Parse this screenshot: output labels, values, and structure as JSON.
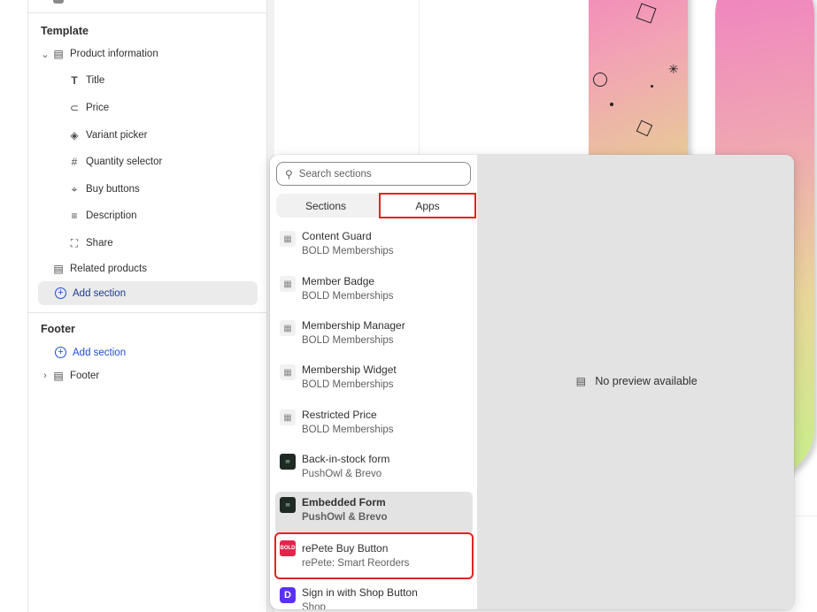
{
  "sidebar": {
    "template_title": "Template",
    "product_information": "Product information",
    "blocks": [
      {
        "label": "Title",
        "icon": "text-icon",
        "glyph": "T"
      },
      {
        "label": "Price",
        "icon": "price-tag-icon",
        "glyph": "⊂$"
      },
      {
        "label": "Variant picker",
        "icon": "variant-icon",
        "glyph": "◈"
      },
      {
        "label": "Quantity selector",
        "icon": "hash-icon",
        "glyph": "#"
      },
      {
        "label": "Buy buttons",
        "icon": "buy-button-icon",
        "glyph": "⌖"
      },
      {
        "label": "Description",
        "icon": "text-lines-icon",
        "glyph": "≡"
      },
      {
        "label": "Share",
        "icon": "share-icon",
        "glyph": "⛶"
      }
    ],
    "related_products": "Related products",
    "add_section": "Add section",
    "footer_title": "Footer",
    "footer_add_section": "Add section",
    "footer_item": "Footer"
  },
  "popover": {
    "search_placeholder": "Search sections",
    "tab_sections": "Sections",
    "tab_apps": "Apps",
    "items": [
      {
        "name": "Content Guard",
        "vendor": "BOLD Memberships",
        "thumb": "app-block-icon"
      },
      {
        "name": "Member Badge",
        "vendor": "BOLD Memberships",
        "thumb": "app-block-icon"
      },
      {
        "name": "Membership Manager",
        "vendor": "BOLD Memberships",
        "thumb": "app-block-icon"
      },
      {
        "name": "Membership Widget",
        "vendor": "BOLD Memberships",
        "thumb": "app-block-icon"
      },
      {
        "name": "Restricted Price",
        "vendor": "BOLD Memberships",
        "thumb": "app-block-icon"
      },
      {
        "name": "Back-in-stock form",
        "vendor": "PushOwl & Brevo",
        "thumb": "pushowl-logo"
      },
      {
        "name": "Embedded Form",
        "vendor": "PushOwl & Brevo",
        "thumb": "pushowl-logo"
      },
      {
        "name": "rePete Buy Button",
        "vendor": "rePete: Smart Reorders",
        "thumb": "bold-logo"
      },
      {
        "name": "Sign in with Shop Button",
        "vendor": "Shop",
        "thumb": "shop-logo"
      }
    ],
    "no_preview": "No preview available"
  },
  "colors": {
    "highlight": "#e02424",
    "link_blue": "#1e4fd1",
    "selected_bg": "#e3e3e3"
  }
}
